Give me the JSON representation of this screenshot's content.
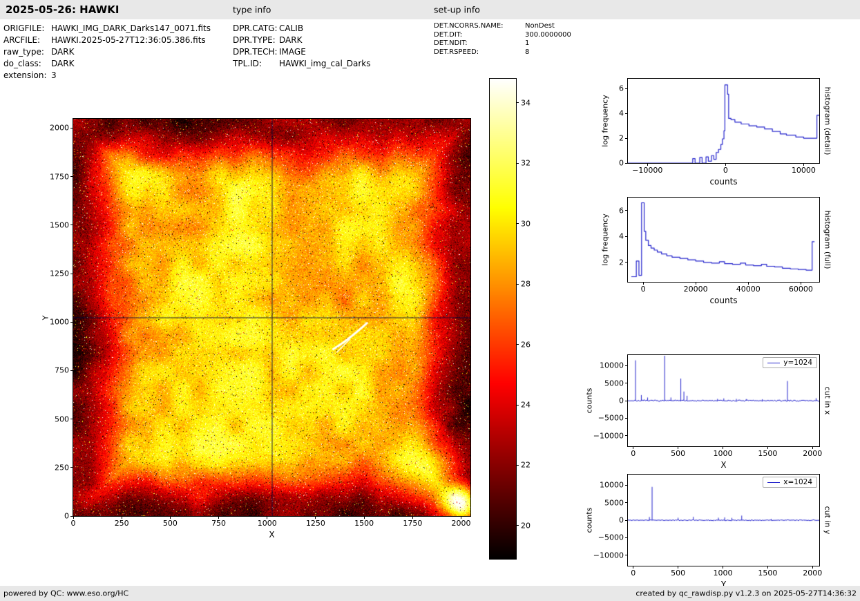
{
  "header": {
    "title": "2025-05-26: HAWKI",
    "type_info_label": "type info",
    "setup_info_label": "set-up info"
  },
  "metadata": {
    "file_block": [
      {
        "label": "ORIGFILE:",
        "value": "HAWKI_IMG_DARK_Darks147_0071.fits"
      },
      {
        "label": "ARCFILE:",
        "value": "HAWKI.2025-05-27T12:36:05.386.fits"
      },
      {
        "label": "raw_type:",
        "value": "DARK"
      },
      {
        "label": "do_class:",
        "value": "DARK"
      },
      {
        "label": "extension:",
        "value": "3"
      }
    ],
    "type_block": [
      {
        "label": "DPR.CATG:",
        "value": "CALIB"
      },
      {
        "label": "DPR.TYPE:",
        "value": "DARK"
      },
      {
        "label": "DPR.TECH:",
        "value": "IMAGE"
      },
      {
        "label": "TPL.ID:",
        "value": "HAWKI_img_cal_Darks"
      }
    ],
    "setup_block": [
      {
        "label": "DET.NCORRS.NAME:",
        "value": "NonDest"
      },
      {
        "label": "DET.DIT:",
        "value": "300.0000000"
      },
      {
        "label": "DET.NDIT:",
        "value": "1"
      },
      {
        "label": "DET.RSPEED:",
        "value": "8"
      }
    ]
  },
  "footer": {
    "left": "powered by QC: www.eso.org/HC",
    "right": "created by qc_rawdisp.py v1.2.3 on 2025-05-27T14:36:32"
  },
  "chart_data": [
    {
      "id": "detector-image",
      "type": "heatmap",
      "xlabel": "X",
      "ylabel": "Y",
      "xlim": [
        0,
        2048
      ],
      "ylim": [
        0,
        2048
      ],
      "xticks": [
        0,
        250,
        500,
        750,
        1000,
        1250,
        1500,
        1750,
        2000
      ],
      "yticks": [
        0,
        250,
        500,
        750,
        1000,
        1250,
        1500,
        1750,
        2000
      ],
      "colormap": "hot",
      "crosshair": {
        "x": 1024,
        "y": 1024
      },
      "bright_corner": {
        "x": 2000,
        "y": 70
      },
      "streak": {
        "from": [
          1340,
          860
        ],
        "to": [
          1515,
          995
        ]
      },
      "value_range": [
        18.9,
        34.8
      ],
      "colorbar": {
        "vmin": 18.9,
        "vmax": 34.8,
        "ticks": [
          20,
          22,
          24,
          26,
          28,
          30,
          32,
          34
        ]
      }
    },
    {
      "id": "histogram-detail",
      "type": "line",
      "color": "#2222cc",
      "xlabel": "counts",
      "ylabel": "log frequency",
      "right_label": "histogram (detail)",
      "xlim": [
        -12500,
        12000
      ],
      "ylim": [
        0,
        6.8
      ],
      "xticks": [
        -10000,
        0,
        10000
      ],
      "yticks": [
        0,
        2,
        4,
        6
      ],
      "points": [
        [
          -12500,
          0
        ],
        [
          -4200,
          0
        ],
        [
          -4200,
          0.35
        ],
        [
          -3900,
          0.35
        ],
        [
          -3900,
          0
        ],
        [
          -3300,
          0
        ],
        [
          -3300,
          0.45
        ],
        [
          -3000,
          0.45
        ],
        [
          -3000,
          0
        ],
        [
          -2500,
          0
        ],
        [
          -2500,
          0.5
        ],
        [
          -2200,
          0.5
        ],
        [
          -2200,
          0.15
        ],
        [
          -1800,
          0.15
        ],
        [
          -1800,
          0.6
        ],
        [
          -1500,
          0.6
        ],
        [
          -1500,
          0.3
        ],
        [
          -1200,
          0.3
        ],
        [
          -1200,
          0.85
        ],
        [
          -900,
          0.85
        ],
        [
          -900,
          1.1
        ],
        [
          -600,
          1.1
        ],
        [
          -600,
          1.5
        ],
        [
          -400,
          1.5
        ],
        [
          -400,
          1.95
        ],
        [
          -200,
          1.95
        ],
        [
          -200,
          2.6
        ],
        [
          -80,
          2.6
        ],
        [
          -80,
          6.3
        ],
        [
          260,
          6.3
        ],
        [
          260,
          5.55
        ],
        [
          400,
          5.55
        ],
        [
          400,
          3.6
        ],
        [
          700,
          3.6
        ],
        [
          700,
          3.5
        ],
        [
          1200,
          3.5
        ],
        [
          1200,
          3.3
        ],
        [
          2000,
          3.3
        ],
        [
          2000,
          3.15
        ],
        [
          3000,
          3.15
        ],
        [
          3000,
          3.0
        ],
        [
          4000,
          3.0
        ],
        [
          4000,
          2.9
        ],
        [
          5000,
          2.9
        ],
        [
          5000,
          2.75
        ],
        [
          6000,
          2.75
        ],
        [
          6000,
          2.55
        ],
        [
          7000,
          2.55
        ],
        [
          7000,
          2.35
        ],
        [
          7800,
          2.35
        ],
        [
          7800,
          2.25
        ],
        [
          9000,
          2.25
        ],
        [
          9000,
          2.1
        ],
        [
          10000,
          2.1
        ],
        [
          10000,
          2.0
        ],
        [
          11700,
          2.0
        ],
        [
          11700,
          3.85
        ],
        [
          12000,
          3.85
        ]
      ]
    },
    {
      "id": "histogram-full",
      "type": "line",
      "color": "#2222cc",
      "xlabel": "counts",
      "ylabel": "log frequency",
      "right_label": "histogram (full)",
      "xlim": [
        -5800,
        67000
      ],
      "ylim": [
        0.5,
        7.0
      ],
      "xticks": [
        0,
        20000,
        40000,
        60000
      ],
      "yticks": [
        2,
        4,
        6
      ],
      "points": [
        [
          -4500,
          0.9
        ],
        [
          -2600,
          0.9
        ],
        [
          -2600,
          2.1
        ],
        [
          -1600,
          2.1
        ],
        [
          -1600,
          1.0
        ],
        [
          -600,
          1.0
        ],
        [
          -600,
          6.6
        ],
        [
          400,
          6.6
        ],
        [
          400,
          4.4
        ],
        [
          1000,
          4.4
        ],
        [
          1000,
          3.7
        ],
        [
          2000,
          3.7
        ],
        [
          2000,
          3.3
        ],
        [
          3000,
          3.3
        ],
        [
          3000,
          3.1
        ],
        [
          4200,
          3.1
        ],
        [
          4200,
          2.95
        ],
        [
          5400,
          2.95
        ],
        [
          5400,
          2.8
        ],
        [
          7000,
          2.8
        ],
        [
          7000,
          2.65
        ],
        [
          9000,
          2.65
        ],
        [
          9000,
          2.5
        ],
        [
          11000,
          2.5
        ],
        [
          11000,
          2.4
        ],
        [
          14000,
          2.4
        ],
        [
          14000,
          2.3
        ],
        [
          17000,
          2.3
        ],
        [
          17000,
          2.2
        ],
        [
          20000,
          2.2
        ],
        [
          20000,
          2.1
        ],
        [
          23000,
          2.1
        ],
        [
          23000,
          2.0
        ],
        [
          26000,
          2.0
        ],
        [
          26000,
          1.95
        ],
        [
          29000,
          1.95
        ],
        [
          29000,
          2.05
        ],
        [
          31000,
          2.05
        ],
        [
          31000,
          1.9
        ],
        [
          34000,
          1.9
        ],
        [
          34000,
          1.85
        ],
        [
          37000,
          1.85
        ],
        [
          37000,
          1.95
        ],
        [
          39000,
          1.95
        ],
        [
          39000,
          1.8
        ],
        [
          42000,
          1.8
        ],
        [
          42000,
          1.75
        ],
        [
          45000,
          1.75
        ],
        [
          45000,
          1.85
        ],
        [
          47000,
          1.85
        ],
        [
          47000,
          1.7
        ],
        [
          50000,
          1.7
        ],
        [
          50000,
          1.65
        ],
        [
          53000,
          1.65
        ],
        [
          53000,
          1.55
        ],
        [
          56000,
          1.55
        ],
        [
          56000,
          1.5
        ],
        [
          59000,
          1.5
        ],
        [
          59000,
          1.45
        ],
        [
          62000,
          1.45
        ],
        [
          62000,
          1.4
        ],
        [
          64300,
          1.4
        ],
        [
          64300,
          3.6
        ],
        [
          65200,
          3.6
        ]
      ]
    },
    {
      "id": "cut-in-x",
      "type": "line",
      "color": "#2222cc",
      "xlabel": "X",
      "ylabel": "counts",
      "right_label": "cut in x",
      "legend": "y=1024",
      "xlim": [
        -60,
        2075
      ],
      "ylim": [
        -13000,
        13000
      ],
      "xticks": [
        0,
        500,
        1000,
        1500,
        2000
      ],
      "yticks": [
        -10000,
        -5000,
        0,
        5000,
        10000
      ],
      "baseline_noise": 300,
      "spikes": [
        [
          25,
          11500
        ],
        [
          90,
          1600
        ],
        [
          160,
          900
        ],
        [
          350,
          12800
        ],
        [
          420,
          900
        ],
        [
          530,
          6300
        ],
        [
          565,
          2600
        ],
        [
          600,
          1400
        ],
        [
          940,
          500
        ],
        [
          1010,
          650
        ],
        [
          1150,
          500
        ],
        [
          1260,
          450
        ],
        [
          1440,
          400
        ],
        [
          1720,
          5600
        ],
        [
          2040,
          700
        ]
      ]
    },
    {
      "id": "cut-in-y",
      "type": "line",
      "color": "#2222cc",
      "xlabel": "Y",
      "ylabel": "counts",
      "right_label": "cut in y",
      "legend": "x=1024",
      "xlim": [
        -60,
        2075
      ],
      "ylim": [
        -13000,
        13000
      ],
      "xticks": [
        0,
        500,
        1000,
        1500,
        2000
      ],
      "yticks": [
        -10000,
        -5000,
        0,
        5000,
        10000
      ],
      "baseline_noise": 220,
      "spikes": [
        [
          180,
          900
        ],
        [
          210,
          9500
        ],
        [
          500,
          700
        ],
        [
          670,
          950
        ],
        [
          950,
          700
        ],
        [
          1020,
          800
        ],
        [
          1100,
          650
        ],
        [
          1210,
          1300
        ],
        [
          1540,
          350
        ]
      ]
    }
  ]
}
